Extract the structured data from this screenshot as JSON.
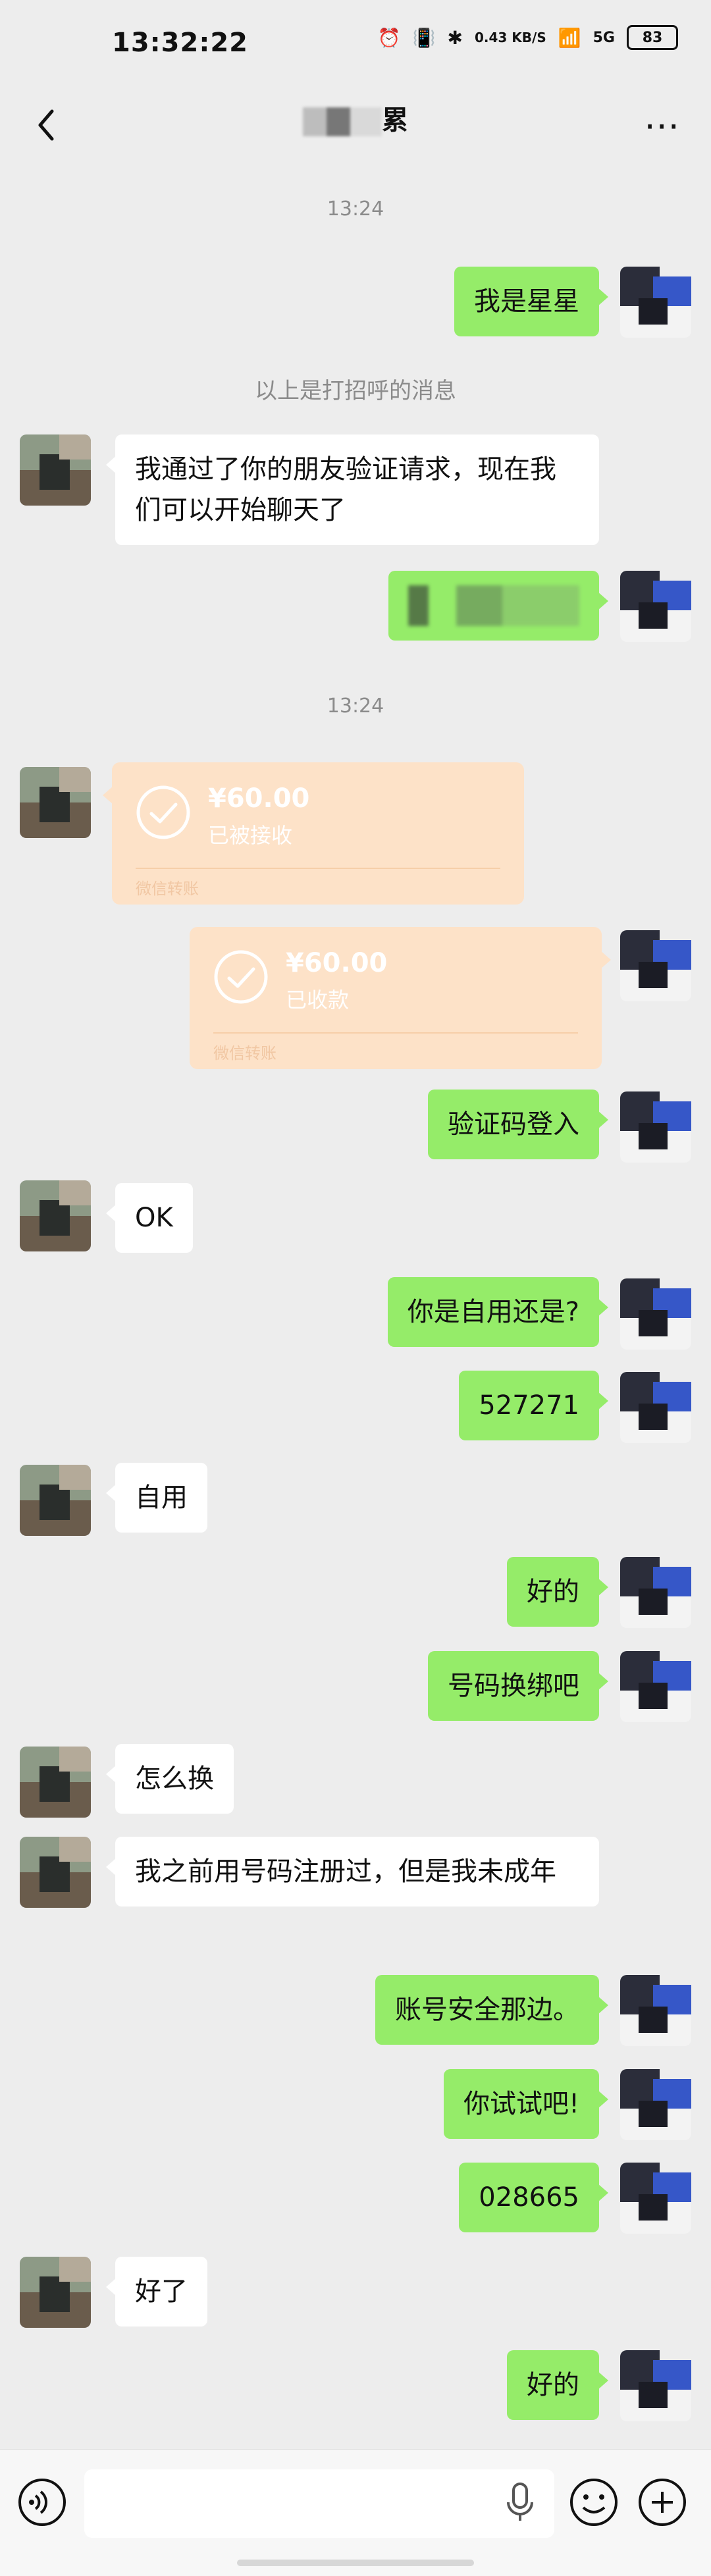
{
  "status_bar": {
    "time": "13:32:22",
    "net_speed": "0.43 KB/S",
    "network": "5G",
    "battery": "83"
  },
  "header": {
    "title": "累",
    "back_icon": "chevron-left-icon",
    "more_icon": "more-dots-icon"
  },
  "chat": {
    "timestamps": [
      "13:24",
      "13:24"
    ],
    "system_message": "以上是打招呼的消息",
    "messages": [
      {
        "from": "me",
        "text": "我是星星"
      },
      {
        "from": "peer",
        "text": "我通过了你的朋友验证请求，现在我们可以开始聊天了"
      },
      {
        "from": "me",
        "text": ""
      },
      {
        "from": "peer",
        "type": "transfer",
        "amount": "¥60.00",
        "status": "已被接收",
        "brand": "微信转账"
      },
      {
        "from": "me",
        "type": "transfer",
        "amount": "¥60.00",
        "status": "已收款",
        "brand": "微信转账"
      },
      {
        "from": "me",
        "text": "验证码登入"
      },
      {
        "from": "peer",
        "text": "OK"
      },
      {
        "from": "me",
        "text": "你是自用还是?"
      },
      {
        "from": "me",
        "text": "527271"
      },
      {
        "from": "peer",
        "text": "自用"
      },
      {
        "from": "me",
        "text": "好的"
      },
      {
        "from": "me",
        "text": "号码换绑吧"
      },
      {
        "from": "peer",
        "text": "怎么换"
      },
      {
        "from": "peer",
        "text": "我之前用号码注册过，但是我未成年"
      },
      {
        "from": "me",
        "text": "账号安全那边。"
      },
      {
        "from": "me",
        "text": "你试试吧!"
      },
      {
        "from": "me",
        "text": "028665"
      },
      {
        "from": "peer",
        "text": "好了"
      },
      {
        "from": "me",
        "text": "好的"
      }
    ]
  },
  "input_bar": {
    "voice_icon": "voice-icon",
    "mic_icon": "mic-icon",
    "emoji_icon": "emoji-icon",
    "plus_icon": "plus-icon"
  },
  "colors": {
    "me_bubble": "#95ec69",
    "peer_bubble": "#ffffff",
    "transfer": "#fde2c8",
    "background": "#ededed"
  }
}
